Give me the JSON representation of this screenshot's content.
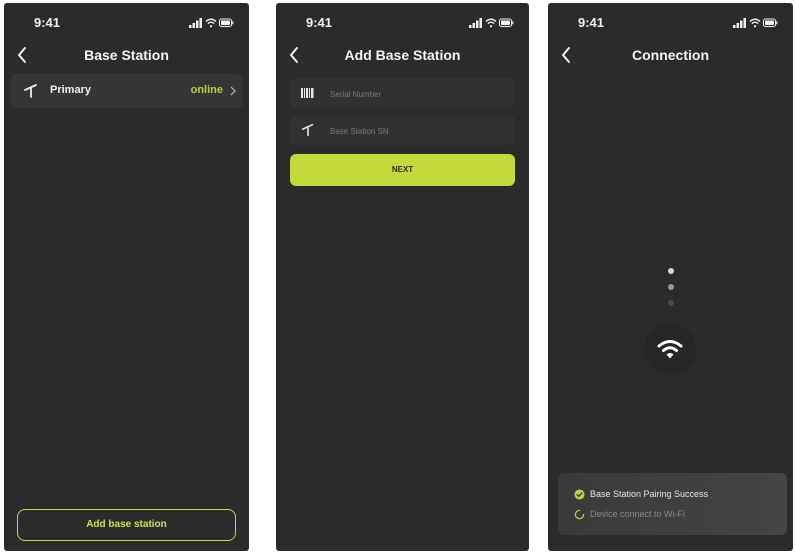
{
  "colors": {
    "accent": "#c4d93a",
    "background": "#2b2b2b",
    "card": "#353535"
  },
  "status_bar": {
    "time": "9:41",
    "icons": [
      "signal-icon",
      "wifi-icon",
      "battery-icon"
    ]
  },
  "screen1": {
    "title": "Base Station",
    "stations": [
      {
        "name": "Primary",
        "status": "online",
        "icon": "antenna-icon"
      }
    ],
    "add_button": "Add base station"
  },
  "screen2": {
    "title": "Add Base Station",
    "fields": [
      {
        "icon": "barcode-icon",
        "placeholder": "Serial Number",
        "value": ""
      },
      {
        "icon": "antenna-icon",
        "placeholder": "Base Station SN",
        "value": ""
      }
    ],
    "next_button": "NEXT"
  },
  "screen3": {
    "title": "Connection",
    "center_icon": "wifi-icon",
    "steps": [
      {
        "label": "Base Station Pairing Success",
        "state": "done",
        "icon": "check-circle-icon"
      },
      {
        "label": "Device connect to Wi-Fi",
        "state": "in-progress",
        "icon": "spinner-icon"
      }
    ]
  }
}
